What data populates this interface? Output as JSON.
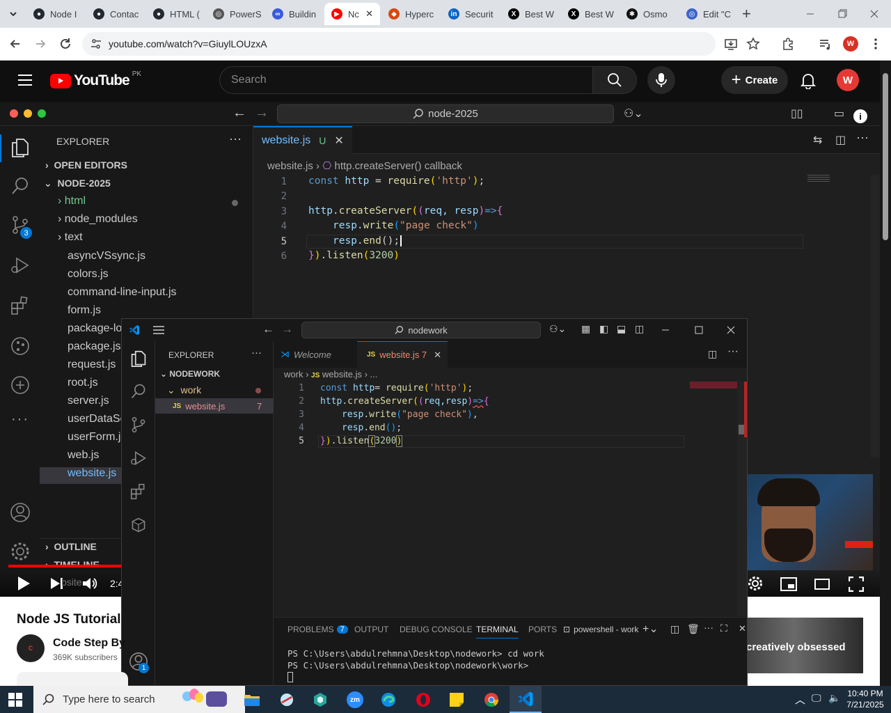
{
  "chrome": {
    "tabs": [
      {
        "label": "Node I",
        "color": "#24292f",
        "glyph": "●"
      },
      {
        "label": "Contac",
        "color": "#24292f",
        "glyph": "●"
      },
      {
        "label": "HTML (",
        "color": "#24292f",
        "glyph": "●"
      },
      {
        "label": "PowerS",
        "color": "#555555",
        "glyph": "◎"
      },
      {
        "label": "Buildin",
        "color": "#3b5bdb",
        "glyph": "∞"
      },
      {
        "label": "Nc",
        "color": "#ff0000",
        "glyph": "▶"
      },
      {
        "label": "Hyperc",
        "color": "#d9480f",
        "glyph": "◆"
      },
      {
        "label": "Securit",
        "color": "#0a66c2",
        "glyph": "in"
      },
      {
        "label": "Best W",
        "color": "#000000",
        "glyph": "X"
      },
      {
        "label": "Best W",
        "color": "#000000",
        "glyph": "X"
      },
      {
        "label": "Osmo",
        "color": "#111111",
        "glyph": "✱"
      },
      {
        "label": "Edit \"C",
        "color": "#3c64c8",
        "glyph": "◎"
      }
    ],
    "url": "youtube.com/watch?v=GiuylLOUzxA",
    "profile_initial": "W"
  },
  "youtube": {
    "logo_text": "YouTube",
    "country": "PK",
    "search_placeholder": "Search",
    "create_label": "Create",
    "avatar_initial": "W",
    "video_title": "Node JS Tutorial",
    "channel_name": "Code Step By",
    "subscribers": "369K subscribers",
    "time_display": "2:4",
    "rec_thumb_text": "creatively obsessed",
    "player_overlay_label": "bsite"
  },
  "vs1": {
    "command_center": "node-2025",
    "explorer_title": "EXPLORER",
    "open_editors": "OPEN EDITORS",
    "folder": "NODE-2025",
    "folders": [
      "html",
      "node_modules",
      "text"
    ],
    "files": [
      "asyncVSsync.js",
      "colors.js",
      "command-line-input.js",
      "form.js",
      "package-lo",
      "package.js",
      "request.js",
      "root.js",
      "server.js",
      "userDataSc",
      "userForm.j",
      "web.js",
      "website.js"
    ],
    "outline": "OUTLINE",
    "timeline": "TIMELINE",
    "tab_file": "website.js",
    "tab_status": "U",
    "breadcrumb_file": "website.js",
    "breadcrumb_symbol": "http.createServer() callback",
    "scm_badge": "3",
    "line_numbers": [
      "1",
      "2",
      "3",
      "4",
      "5",
      "6"
    ],
    "code": {
      "l1_kw": "const",
      "l1_var": "http",
      "l1_op": "=",
      "l1_fn": "require",
      "l1_str": "'http'",
      "l1_end": ");",
      "l3_obj": "http",
      "l3_fn": "createServer",
      "l3_args": "req, resp",
      "l4_obj": "resp",
      "l4_fn": "write",
      "l4_str": "\"page check\"",
      "l5_obj": "resp",
      "l5_fn": "end",
      "l5_end": "();",
      "l6_fn": "listen",
      "l6_num": "3200"
    }
  },
  "vs2": {
    "command_center": "nodework",
    "explorer_title": "EXPLORER",
    "folder": "NODEWORK",
    "subfolder": "work",
    "file": "website.js",
    "file_problems": "7",
    "tab_welcome": "Welcome",
    "tab_file": "website.js 7",
    "breadcrumb_folder": "work",
    "breadcrumb_file": "website.js",
    "breadcrumb_more": "...",
    "accounts_badge": "1",
    "line_numbers": [
      "1",
      "2",
      "3",
      "4",
      "5"
    ],
    "code": {
      "l1_kw": "const",
      "l1_var": "http",
      "l1_fn": "require",
      "l1_str": "'http'",
      "l2_obj": "http",
      "l2_fn": "createServer",
      "l2_args": "req,resp",
      "l3_obj": "resp",
      "l3_fn": "write",
      "l3_str": "\"page check\"",
      "l4_obj": "resp",
      "l4_fn": "end",
      "l5_fn": "listen",
      "l5_num": "3200"
    },
    "panel": {
      "problems": "PROBLEMS",
      "problems_count": "7",
      "output": "OUTPUT",
      "debug": "DEBUG CONSOLE",
      "terminal": "TERMINAL",
      "ports": "PORTS",
      "shell": "powershell - work",
      "line1": "PS C:\\Users\\abdulrehmna\\Desktop\\nodework> cd work",
      "line2": "PS C:\\Users\\abdulrehmna\\Desktop\\nodework\\work>"
    }
  },
  "taskbar": {
    "search_placeholder": "Type here to search",
    "time": "10:40 PM",
    "date": "7/21/2025",
    "zoom_label": "zm"
  }
}
